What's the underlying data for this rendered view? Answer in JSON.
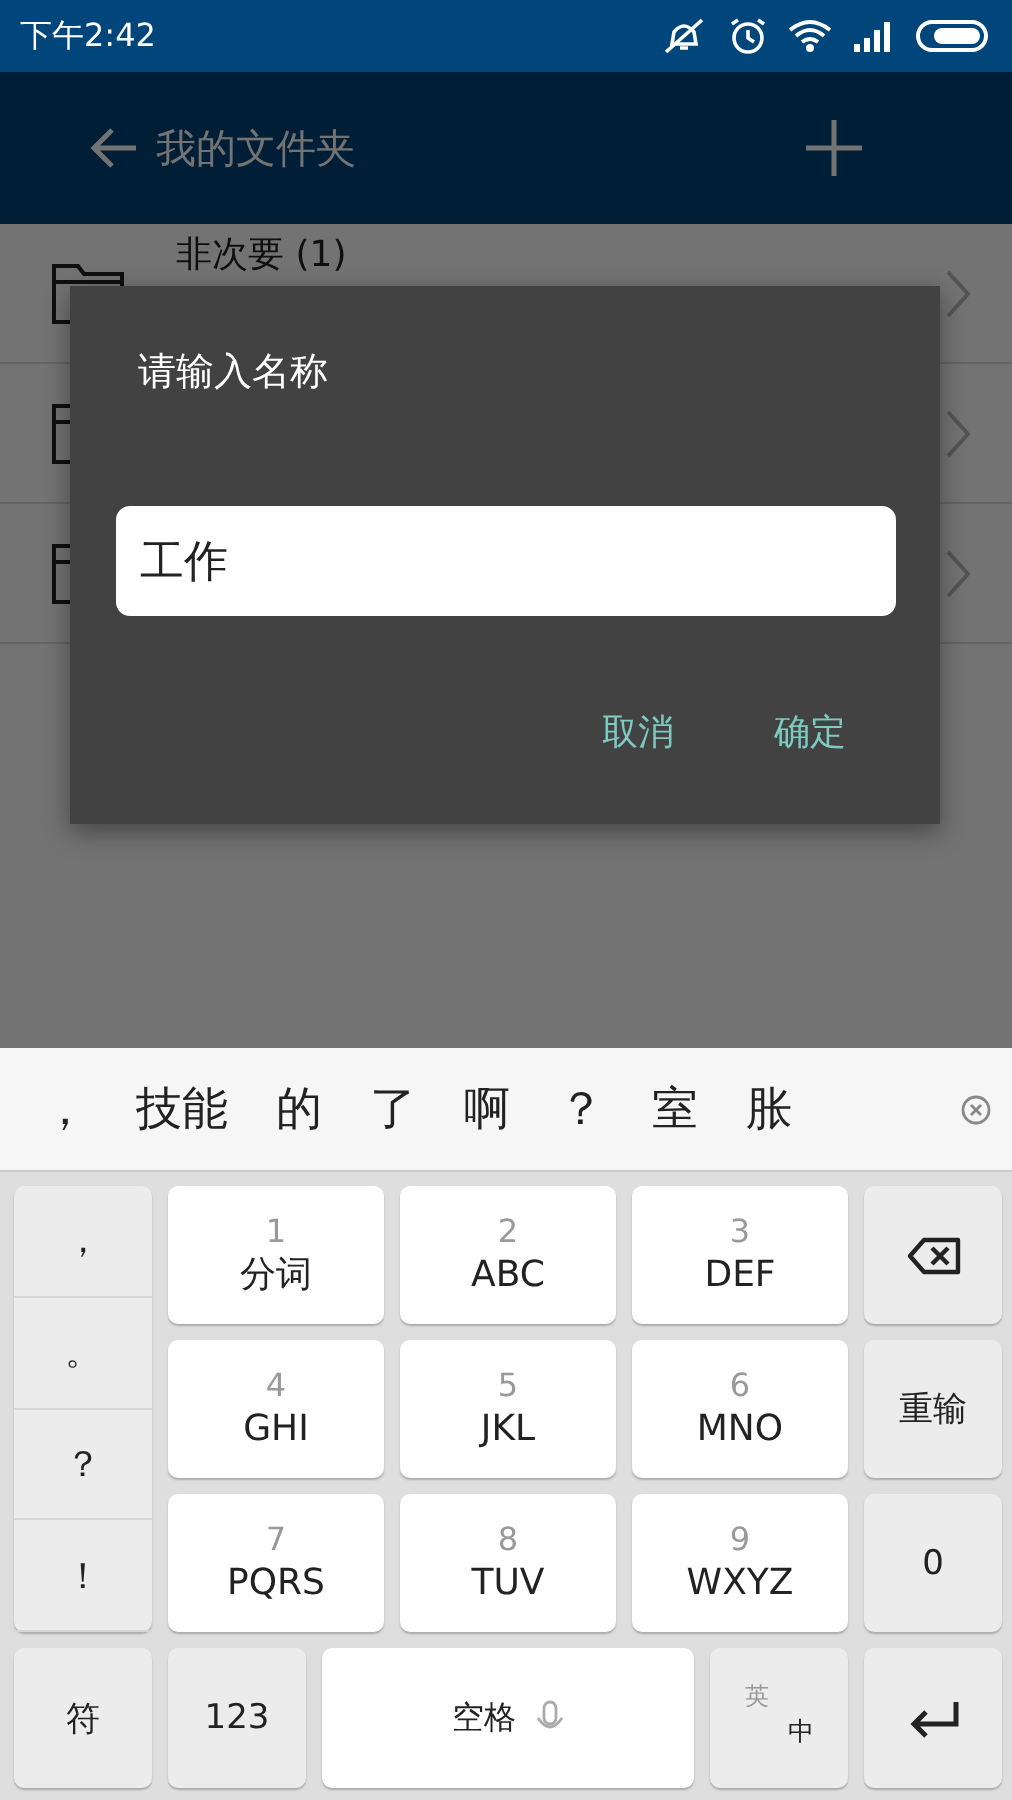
{
  "status_bar": {
    "time": "下午2:42"
  },
  "app_bar": {
    "title": "我的文件夹"
  },
  "folders": [
    {
      "kind": "folder",
      "name": "非次要 (1)"
    },
    {
      "kind": "folder"
    },
    {
      "kind": "folder"
    }
  ],
  "dialog": {
    "title": "请输入名称",
    "input_value": "工作",
    "buttons": [
      "取消",
      "确定"
    ]
  },
  "keyboard": {
    "candidates": [
      "，",
      "技能",
      "的",
      "了",
      "啊",
      "？",
      "室",
      "胀"
    ],
    "symbols": [
      "，",
      "。",
      "？",
      "！"
    ],
    "keys": [
      {
        "digit": "1",
        "letters": "分词"
      },
      {
        "digit": "2",
        "letters": "ABC"
      },
      {
        "digit": "3",
        "letters": "DEF"
      },
      {
        "digit": "4",
        "letters": "GHI"
      },
      {
        "digit": "5",
        "letters": "JKL"
      },
      {
        "digit": "6",
        "letters": "MNO"
      },
      {
        "digit": "7",
        "letters": "PQRS"
      },
      {
        "digit": "8",
        "letters": "TUV"
      },
      {
        "digit": "9",
        "letters": "WXYZ"
      }
    ],
    "side_keys": [
      {
        "kind": "backspace"
      },
      {
        "kind": "text",
        "label": "重输"
      },
      {
        "kind": "text",
        "label": "0"
      }
    ],
    "bottom_keys": [
      {
        "kind": "text",
        "label": "符"
      },
      {
        "kind": "text",
        "label": "123"
      },
      {
        "kind": "space",
        "label": "空格"
      },
      {
        "kind": "lang",
        "top": "英",
        "bottom": "中"
      },
      {
        "kind": "enter"
      }
    ]
  }
}
